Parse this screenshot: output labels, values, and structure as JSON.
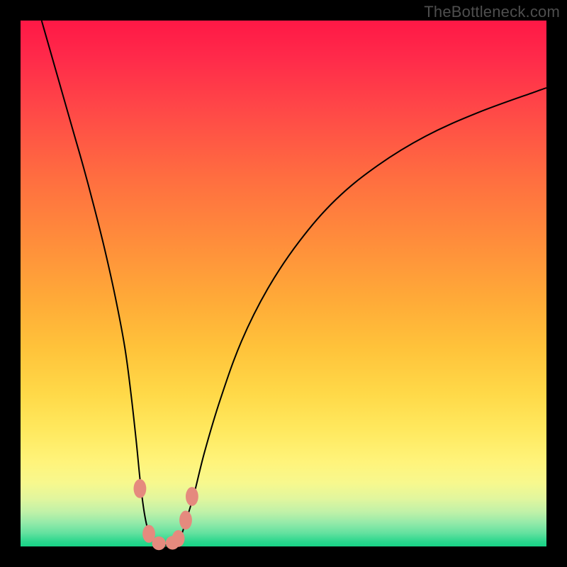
{
  "watermark": "TheBottleneck.com",
  "chart_data": {
    "type": "line",
    "title": "",
    "xlabel": "",
    "ylabel": "",
    "xlim": [
      0,
      100
    ],
    "ylim": [
      0,
      100
    ],
    "grid": false,
    "legend": false,
    "series": [
      {
        "name": "left-branch",
        "x": [
          4.0,
          6.0,
          8.0,
          10.0,
          12.0,
          14.0,
          16.0,
          18.0,
          19.8,
          21.0,
          22.0,
          22.8,
          23.6,
          24.5,
          25.5
        ],
        "y": [
          100.0,
          93.0,
          86.0,
          79.0,
          72.0,
          64.5,
          56.5,
          47.5,
          38.0,
          29.0,
          20.0,
          12.0,
          6.0,
          2.2,
          0.6
        ]
      },
      {
        "name": "right-branch",
        "x": [
          29.5,
          30.5,
          31.5,
          33.0,
          35.0,
          38.0,
          42.0,
          47.0,
          53.0,
          60.0,
          68.0,
          77.0,
          87.0,
          98.0,
          100.0
        ],
        "y": [
          0.6,
          2.0,
          5.0,
          10.0,
          18.0,
          28.0,
          39.0,
          49.0,
          58.0,
          66.0,
          72.5,
          78.0,
          82.5,
          86.5,
          87.2
        ]
      },
      {
        "name": "valley-floor",
        "x": [
          25.5,
          26.5,
          27.5,
          28.5,
          29.5
        ],
        "y": [
          0.6,
          0.3,
          0.25,
          0.3,
          0.6
        ]
      }
    ],
    "markers": [
      {
        "name": "bead-left-upper",
        "x": 22.7,
        "y": 11.0,
        "rx": 1.2,
        "ry": 1.8
      },
      {
        "name": "bead-left-lower",
        "x": 24.4,
        "y": 2.4,
        "rx": 1.2,
        "ry": 1.7
      },
      {
        "name": "bead-floor-left",
        "x": 26.3,
        "y": 0.6,
        "rx": 1.3,
        "ry": 1.3
      },
      {
        "name": "bead-floor-right",
        "x": 28.9,
        "y": 0.7,
        "rx": 1.3,
        "ry": 1.3
      },
      {
        "name": "bead-right-lower",
        "x": 30.0,
        "y": 1.5,
        "rx": 1.2,
        "ry": 1.6
      },
      {
        "name": "bead-right-upper",
        "x": 31.4,
        "y": 5.0,
        "rx": 1.2,
        "ry": 1.8
      },
      {
        "name": "bead-right-upper2",
        "x": 32.6,
        "y": 9.5,
        "rx": 1.2,
        "ry": 1.8
      }
    ],
    "gradient_stops": [
      {
        "pos": 0,
        "color": "#ff1846"
      },
      {
        "pos": 7,
        "color": "#ff2a4a"
      },
      {
        "pos": 18,
        "color": "#ff4b47"
      },
      {
        "pos": 30,
        "color": "#ff6e40"
      },
      {
        "pos": 42,
        "color": "#ff8d3b"
      },
      {
        "pos": 53,
        "color": "#ffaa38"
      },
      {
        "pos": 62,
        "color": "#ffc23a"
      },
      {
        "pos": 71,
        "color": "#ffd948"
      },
      {
        "pos": 78,
        "color": "#ffe95f"
      },
      {
        "pos": 84,
        "color": "#fff47b"
      },
      {
        "pos": 88,
        "color": "#f7f88e"
      },
      {
        "pos": 91,
        "color": "#e0f69e"
      },
      {
        "pos": 93.5,
        "color": "#bff1a8"
      },
      {
        "pos": 95.5,
        "color": "#94eaa9"
      },
      {
        "pos": 97.5,
        "color": "#62e19f"
      },
      {
        "pos": 99,
        "color": "#2dd78e"
      },
      {
        "pos": 100,
        "color": "#17d386"
      }
    ]
  }
}
